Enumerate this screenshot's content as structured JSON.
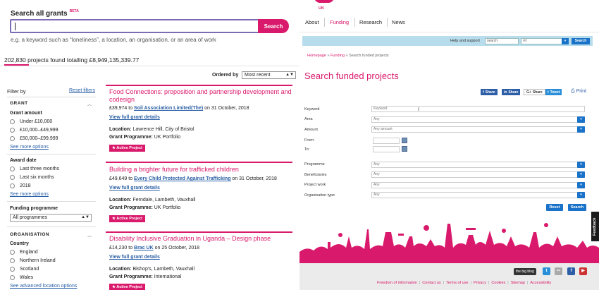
{
  "left": {
    "search_title": "Search all grants",
    "beta": "BETA",
    "search_value": "",
    "search_button": "Search",
    "hint": "e.g. a keyword such as “loneliness”, a location, an organisation, or an area of work",
    "results_count": "202,830 projects found totalling £8,949,135,339.77",
    "ordered_by_label": "Ordered by",
    "ordered_by_value": "Most recent",
    "filters": {
      "filter_by": "Filter by",
      "reset": "Reset filters",
      "grant_heading": "GRANT",
      "grant_amount": "Grant amount",
      "amount_options": [
        "Under £10,000",
        "£10,000–£49,999",
        "£50,000–£99,999"
      ],
      "see_more_options": "See more options",
      "award_date": "Award date",
      "date_options": [
        "Last three months",
        "Last six months",
        "2018"
      ],
      "funding_programme": "Funding programme",
      "programme_select": "All programmes",
      "organisation_heading": "ORGANISATION",
      "country": "Country",
      "country_options": [
        "England",
        "Northern Ireland",
        "Scotland",
        "Wales"
      ],
      "see_advanced": "See advanced location options"
    },
    "results": [
      {
        "title": "Food Connections: proposition and partnership development and codesign",
        "amount": "£39,974 to ",
        "org": "Soil Association Limited(The)",
        "date": " on 31 October, 2018",
        "view": "View full grant details",
        "location_label": "Location:",
        "location": " Lawrence Hill, City of Bristol",
        "programme_label": "Grant Programme:",
        "programme": " UK Portfolio",
        "badge": "★ Active Project"
      },
      {
        "title": "Building a brighter future for trafficked children",
        "amount": "£49,649 to ",
        "org": "Every Child Protected Against Trafficking",
        "date": " on 31 October, 2018",
        "view": "View full grant details",
        "location_label": "Location:",
        "location": " Ferndale, Lambeth, Vauxhall",
        "programme_label": "Grant Programme:",
        "programme": " UK Portfolio",
        "badge": "★ Active Project"
      },
      {
        "title": "Disability Inclusive Graduation in Uganda – Design phase",
        "amount": "£14,230 to ",
        "org": "Brac UK",
        "date": " on 25 October, 2018",
        "view": "View full grant details",
        "location_label": "Location:",
        "location": " Bishop's, Lambeth, Vauxhall",
        "programme_label": "Grant Programme:",
        "programme": " International",
        "badge": "★ Active Project"
      }
    ]
  },
  "right": {
    "logo_sub": "UK",
    "nav": [
      "About",
      "Funding",
      "Research",
      "News"
    ],
    "help_label": "Help and support",
    "help_search_value": "search",
    "help_select": "All",
    "help_button": "Search",
    "breadcrumb": {
      "home": "Homepage",
      "sep": " » ",
      "funding": "Funding",
      "current": "Search funded projects"
    },
    "heading": "Search funded projects",
    "share": [
      {
        "icon": "f",
        "label": "Share"
      },
      {
        "icon": "in",
        "label": "Share"
      },
      {
        "icon": "G+",
        "label": "Share"
      },
      {
        "icon": "t",
        "label": "Tweet"
      }
    ],
    "print": "Print",
    "form": {
      "keyword_label": "Keyword",
      "keyword_value": "Keyword",
      "area_label": "Area",
      "area_value": "Any",
      "amount_label": "Amount",
      "amount_value": "Any amount",
      "from_label": "From:",
      "to_label": "To:",
      "programme_label": "Programme",
      "programme_value": "Any",
      "beneficiaries_label": "Beneficiaries",
      "beneficiaries_value": "Any",
      "project_work_label": "Project work",
      "project_work_value": "Any",
      "org_type_label": "Organisation type",
      "org_type_value": "Any",
      "reset": "Reset",
      "search": "Search"
    },
    "feedback": "Feedback",
    "big_blog": "the big blog",
    "footer_links": [
      "Freedom of information",
      "Contact us",
      "Terms of use",
      "Privacy",
      "Cookies",
      "Sitemap",
      "Accessibility"
    ],
    "colors": {
      "brand_pink": "#d9196b",
      "blue": "#1a73c8",
      "help_bar": "#b7dceb"
    }
  }
}
